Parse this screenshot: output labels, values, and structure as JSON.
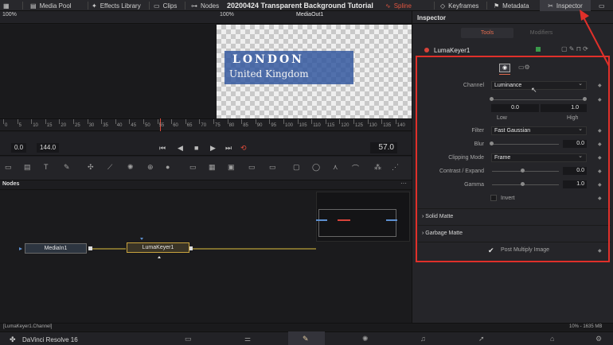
{
  "topbar": {
    "media_pool": "Media Pool",
    "effects_library": "Effects Library",
    "clips": "Clips",
    "nodes": "Nodes",
    "project_title": "20200424 Transparent Background Tutorial",
    "spline": "Spline",
    "keyframes": "Keyframes",
    "metadata": "Metadata",
    "inspector": "Inspector"
  },
  "viewerbar": {
    "zoom_left": "100%",
    "zoom_right": "100%",
    "output": "MediaOut1"
  },
  "viewer": {
    "line1": "LONDON",
    "line2": "United Kingdom"
  },
  "ruler": {
    "ticks": [
      "0",
      "5",
      "10",
      "15",
      "20",
      "25",
      "30",
      "35",
      "40",
      "45",
      "50",
      "55",
      "60",
      "65",
      "70",
      "75",
      "80",
      "85",
      "90",
      "95",
      "100",
      "105",
      "110",
      "115",
      "120",
      "125",
      "130",
      "135",
      "140"
    ]
  },
  "transport": {
    "start": "0.0",
    "end": "144.0",
    "current": "57.0"
  },
  "nodes_panel": {
    "title": "Nodes",
    "node1": "MediaIn1",
    "node2": "LumaKeyer1"
  },
  "status": {
    "left": "[LumaKeyer1.Channel]",
    "right": "10% - 1635 MB"
  },
  "bottom": {
    "app_name": "DaVinci Resolve 16"
  },
  "inspector": {
    "title": "Inspector",
    "tab_tools": "Tools",
    "tab_modifiers": "Modifiers",
    "node_name": "LumaKeyer1",
    "channel_label": "Channel",
    "channel_value": "Luminance",
    "low_value": "0.0",
    "high_value": "1.0",
    "low_label": "Low",
    "high_label": "High",
    "filter_label": "Filter",
    "filter_value": "Fast Gaussian",
    "blur_label": "Blur",
    "blur_value": "0.0",
    "clipping_label": "Clipping Mode",
    "clipping_value": "Frame",
    "contrast_label": "Contrast / Expand",
    "contrast_value": "0.0",
    "gamma_label": "Gamma",
    "gamma_value": "1.0",
    "invert_label": "Invert",
    "solid_matte": "Solid Matte",
    "garbage_matte": "Garbage Matte",
    "post_multiply": "Post Multiply Image"
  },
  "colors": {
    "accent_red": "#e0302a",
    "keyer_orange": "#e26b4f",
    "text_blue_bg": "#2e549e"
  }
}
